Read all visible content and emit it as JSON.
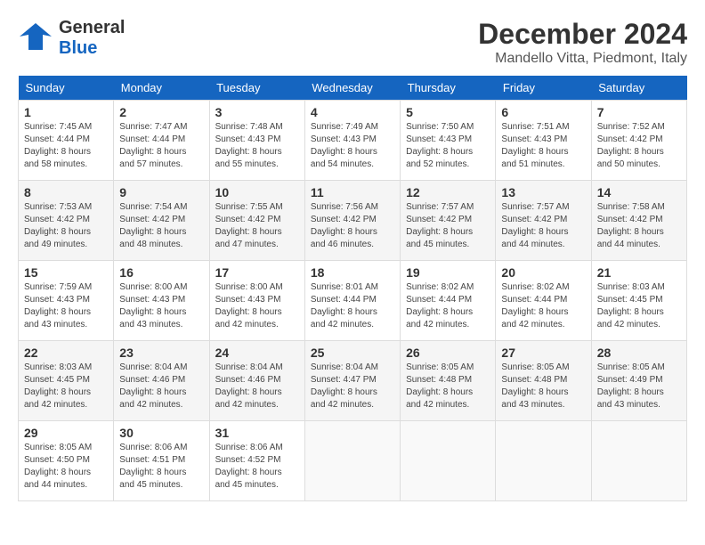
{
  "header": {
    "logo_general": "General",
    "logo_blue": "Blue",
    "title": "December 2024",
    "subtitle": "Mandello Vitta, Piedmont, Italy"
  },
  "calendar": {
    "days_of_week": [
      "Sunday",
      "Monday",
      "Tuesday",
      "Wednesday",
      "Thursday",
      "Friday",
      "Saturday"
    ],
    "weeks": [
      [
        {
          "day": "1",
          "sunrise": "Sunrise: 7:45 AM",
          "sunset": "Sunset: 4:44 PM",
          "daylight": "Daylight: 8 hours and 58 minutes."
        },
        {
          "day": "2",
          "sunrise": "Sunrise: 7:47 AM",
          "sunset": "Sunset: 4:44 PM",
          "daylight": "Daylight: 8 hours and 57 minutes."
        },
        {
          "day": "3",
          "sunrise": "Sunrise: 7:48 AM",
          "sunset": "Sunset: 4:43 PM",
          "daylight": "Daylight: 8 hours and 55 minutes."
        },
        {
          "day": "4",
          "sunrise": "Sunrise: 7:49 AM",
          "sunset": "Sunset: 4:43 PM",
          "daylight": "Daylight: 8 hours and 54 minutes."
        },
        {
          "day": "5",
          "sunrise": "Sunrise: 7:50 AM",
          "sunset": "Sunset: 4:43 PM",
          "daylight": "Daylight: 8 hours and 52 minutes."
        },
        {
          "day": "6",
          "sunrise": "Sunrise: 7:51 AM",
          "sunset": "Sunset: 4:43 PM",
          "daylight": "Daylight: 8 hours and 51 minutes."
        },
        {
          "day": "7",
          "sunrise": "Sunrise: 7:52 AM",
          "sunset": "Sunset: 4:42 PM",
          "daylight": "Daylight: 8 hours and 50 minutes."
        }
      ],
      [
        {
          "day": "8",
          "sunrise": "Sunrise: 7:53 AM",
          "sunset": "Sunset: 4:42 PM",
          "daylight": "Daylight: 8 hours and 49 minutes."
        },
        {
          "day": "9",
          "sunrise": "Sunrise: 7:54 AM",
          "sunset": "Sunset: 4:42 PM",
          "daylight": "Daylight: 8 hours and 48 minutes."
        },
        {
          "day": "10",
          "sunrise": "Sunrise: 7:55 AM",
          "sunset": "Sunset: 4:42 PM",
          "daylight": "Daylight: 8 hours and 47 minutes."
        },
        {
          "day": "11",
          "sunrise": "Sunrise: 7:56 AM",
          "sunset": "Sunset: 4:42 PM",
          "daylight": "Daylight: 8 hours and 46 minutes."
        },
        {
          "day": "12",
          "sunrise": "Sunrise: 7:57 AM",
          "sunset": "Sunset: 4:42 PM",
          "daylight": "Daylight: 8 hours and 45 minutes."
        },
        {
          "day": "13",
          "sunrise": "Sunrise: 7:57 AM",
          "sunset": "Sunset: 4:42 PM",
          "daylight": "Daylight: 8 hours and 44 minutes."
        },
        {
          "day": "14",
          "sunrise": "Sunrise: 7:58 AM",
          "sunset": "Sunset: 4:42 PM",
          "daylight": "Daylight: 8 hours and 44 minutes."
        }
      ],
      [
        {
          "day": "15",
          "sunrise": "Sunrise: 7:59 AM",
          "sunset": "Sunset: 4:43 PM",
          "daylight": "Daylight: 8 hours and 43 minutes."
        },
        {
          "day": "16",
          "sunrise": "Sunrise: 8:00 AM",
          "sunset": "Sunset: 4:43 PM",
          "daylight": "Daylight: 8 hours and 43 minutes."
        },
        {
          "day": "17",
          "sunrise": "Sunrise: 8:00 AM",
          "sunset": "Sunset: 4:43 PM",
          "daylight": "Daylight: 8 hours and 42 minutes."
        },
        {
          "day": "18",
          "sunrise": "Sunrise: 8:01 AM",
          "sunset": "Sunset: 4:44 PM",
          "daylight": "Daylight: 8 hours and 42 minutes."
        },
        {
          "day": "19",
          "sunrise": "Sunrise: 8:02 AM",
          "sunset": "Sunset: 4:44 PM",
          "daylight": "Daylight: 8 hours and 42 minutes."
        },
        {
          "day": "20",
          "sunrise": "Sunrise: 8:02 AM",
          "sunset": "Sunset: 4:44 PM",
          "daylight": "Daylight: 8 hours and 42 minutes."
        },
        {
          "day": "21",
          "sunrise": "Sunrise: 8:03 AM",
          "sunset": "Sunset: 4:45 PM",
          "daylight": "Daylight: 8 hours and 42 minutes."
        }
      ],
      [
        {
          "day": "22",
          "sunrise": "Sunrise: 8:03 AM",
          "sunset": "Sunset: 4:45 PM",
          "daylight": "Daylight: 8 hours and 42 minutes."
        },
        {
          "day": "23",
          "sunrise": "Sunrise: 8:04 AM",
          "sunset": "Sunset: 4:46 PM",
          "daylight": "Daylight: 8 hours and 42 minutes."
        },
        {
          "day": "24",
          "sunrise": "Sunrise: 8:04 AM",
          "sunset": "Sunset: 4:46 PM",
          "daylight": "Daylight: 8 hours and 42 minutes."
        },
        {
          "day": "25",
          "sunrise": "Sunrise: 8:04 AM",
          "sunset": "Sunset: 4:47 PM",
          "daylight": "Daylight: 8 hours and 42 minutes."
        },
        {
          "day": "26",
          "sunrise": "Sunrise: 8:05 AM",
          "sunset": "Sunset: 4:48 PM",
          "daylight": "Daylight: 8 hours and 42 minutes."
        },
        {
          "day": "27",
          "sunrise": "Sunrise: 8:05 AM",
          "sunset": "Sunset: 4:48 PM",
          "daylight": "Daylight: 8 hours and 43 minutes."
        },
        {
          "day": "28",
          "sunrise": "Sunrise: 8:05 AM",
          "sunset": "Sunset: 4:49 PM",
          "daylight": "Daylight: 8 hours and 43 minutes."
        }
      ],
      [
        {
          "day": "29",
          "sunrise": "Sunrise: 8:05 AM",
          "sunset": "Sunset: 4:50 PM",
          "daylight": "Daylight: 8 hours and 44 minutes."
        },
        {
          "day": "30",
          "sunrise": "Sunrise: 8:06 AM",
          "sunset": "Sunset: 4:51 PM",
          "daylight": "Daylight: 8 hours and 45 minutes."
        },
        {
          "day": "31",
          "sunrise": "Sunrise: 8:06 AM",
          "sunset": "Sunset: 4:52 PM",
          "daylight": "Daylight: 8 hours and 45 minutes."
        },
        null,
        null,
        null,
        null
      ]
    ]
  }
}
